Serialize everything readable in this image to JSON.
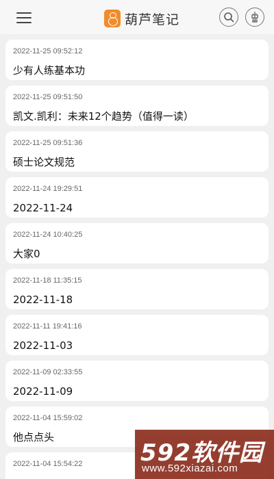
{
  "header": {
    "app_name": "葫芦笔记",
    "menu_icon": "menu-icon",
    "search_icon": "search-icon",
    "robot_icon": "robot-icon"
  },
  "notes": [
    {
      "time": "2022-11-25 09:52:12",
      "title": "少有人练基本功"
    },
    {
      "time": "2022-11-25 09:51:50",
      "title": "凯文.凯利：未来12个趋势（值得一读）"
    },
    {
      "time": "2022-11-25 09:51:36",
      "title": "硕士论文规范"
    },
    {
      "time": "2022-11-24 19:29:51",
      "title": "2022-11-24"
    },
    {
      "time": "2022-11-24 10:40:25",
      "title": "大家0"
    },
    {
      "time": "2022-11-18 11:35:15",
      "title": "2022-11-18"
    },
    {
      "time": "2022-11-11 19:41:16",
      "title": "2022-11-03"
    },
    {
      "time": "2022-11-09 02:33:55",
      "title": "2022-11-09"
    },
    {
      "time": "2022-11-04 15:59:02",
      "title": "他点点头"
    },
    {
      "time": "2022-11-04 15:54:22",
      "title": ""
    }
  ],
  "watermark": {
    "title": "592软件园",
    "url": "www.592xiazai.com"
  }
}
